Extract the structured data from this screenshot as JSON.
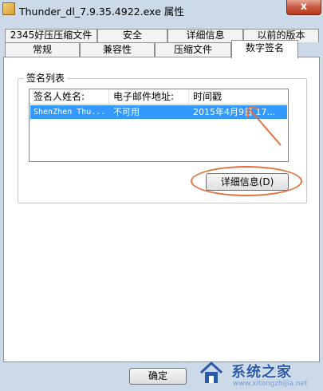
{
  "window": {
    "title": "Thunder_dl_7.9.35.4922.exe 属性",
    "close_label": "x"
  },
  "tabs_row1": [
    {
      "label": "2345好压压缩文件"
    },
    {
      "label": "安全"
    },
    {
      "label": "详细信息"
    },
    {
      "label": "以前的版本"
    }
  ],
  "tabs_row2": [
    {
      "label": "常规"
    },
    {
      "label": "兼容性"
    },
    {
      "label": "压缩文件"
    },
    {
      "label": "数字签名"
    }
  ],
  "signature_list": {
    "group_title": "签名列表",
    "columns": [
      "签名人姓名:",
      "电子邮件地址:",
      "时间戳"
    ],
    "rows": [
      {
        "signer": "ShenZhen Thu...",
        "email": "不可用",
        "timestamp": "2015年4月9日 17..."
      }
    ]
  },
  "buttons": {
    "details": "详细信息(D)",
    "ok": "确定"
  },
  "watermark": {
    "text": "系统之家",
    "url": "www.xitongzhijia.net"
  },
  "colors": {
    "selection": "#3399ff",
    "annotation": "#e5703d",
    "window_frame": "#cbd9e9"
  }
}
